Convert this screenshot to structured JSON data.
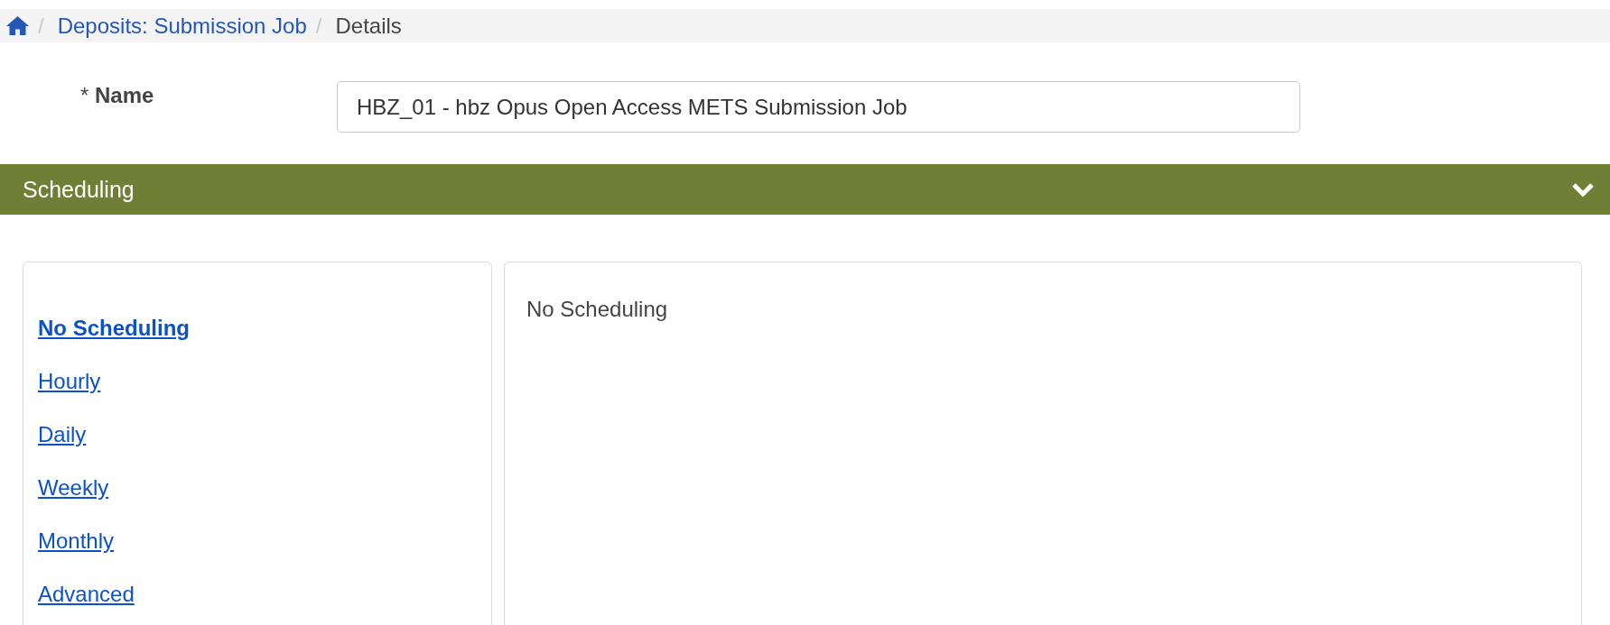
{
  "breadcrumb": [
    {
      "kind": "home"
    },
    {
      "kind": "link",
      "separator": "/",
      "label": "Deposits: Submission Job"
    },
    {
      "kind": "current",
      "separator": "/",
      "label": "Details"
    }
  ],
  "name_field": {
    "label": "* **Name**",
    "value": "HBZ_01 - hbz Opus Open Access METS Submission Job"
  },
  "scheduling": {
    "title": "Scheduling",
    "expanded": true,
    "options": [
      {
        "label": "No Scheduling",
        "selected": true
      },
      {
        "label": "Hourly",
        "selected": false
      },
      {
        "label": "Daily",
        "selected": false
      },
      {
        "label": "Weekly",
        "selected": false
      },
      {
        "label": "Monthly",
        "selected": false
      },
      {
        "label": "Advanced",
        "selected": false
      }
    ],
    "detail": "No Scheduling"
  }
}
